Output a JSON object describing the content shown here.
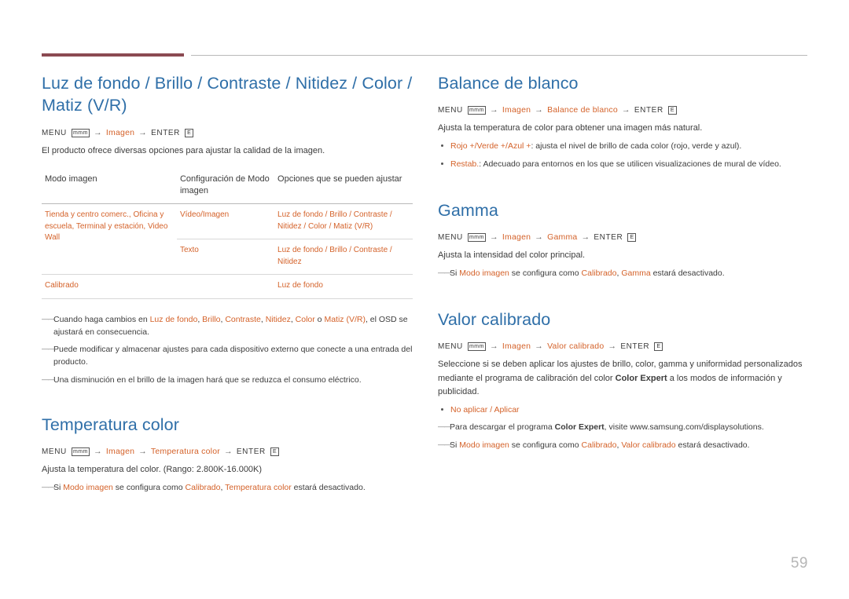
{
  "page": {
    "number": "59"
  },
  "left": {
    "title1": "Luz de fondo / Brillo / Contraste / Nitidez / Color / Matiz (V/R)",
    "path1": {
      "menu": "MENU",
      "menu_glyph": "mmm",
      "arrow": "→",
      "item1": "Imagen",
      "enter": "ENTER",
      "enter_glyph": "E"
    },
    "intro1": "El producto ofrece diversas opciones para ajustar la calidad de la imagen.",
    "table": {
      "headers": [
        "Modo imagen",
        "Configuración de Modo imagen",
        "Opciones que se pueden ajustar"
      ],
      "rows": [
        {
          "mode": "Tienda y centro comerc., Oficina y escuela, Terminal y estación, Video Wall",
          "config": "Vídeo/Imagen",
          "options": "Luz de fondo / Brillo / Contraste / Nitidez / Color / Matiz (V/R)"
        },
        {
          "mode": "",
          "config": "Texto",
          "options": "Luz de fondo / Brillo / Contraste / Nitidez"
        },
        {
          "mode": "Calibrado",
          "config": "",
          "options": "Luz de fondo"
        }
      ]
    },
    "notes": [
      "Cuando haga cambios en Luz de fondo, Brillo, Contraste, Nitidez, Color o Matiz (V/R), el OSD se ajustará en consecuencia.",
      "Puede modificar y almacenar ajustes para cada dispositivo externo que conecte a una entrada del producto.",
      "Una disminución en el brillo de la imagen hará que se reduzca el consumo eléctrico."
    ],
    "note1_parts": {
      "a": "Cuando haga cambios en ",
      "k1": "Luz de fondo",
      "s1": ", ",
      "k2": "Brillo",
      "s2": ", ",
      "k3": "Contraste",
      "s3": ", ",
      "k4": "Nitidez",
      "s4": ", ",
      "k5": "Color",
      "s5": " o ",
      "k6": "Matiz (V/R)",
      "b": ", el OSD se ajustará en consecuencia."
    },
    "title2": "Temperatura color",
    "path2": {
      "menu": "MENU",
      "menu_glyph": "mmm",
      "arrow": "→",
      "item1": "Imagen",
      "item2": "Temperatura color",
      "enter": "ENTER",
      "enter_glyph": "E"
    },
    "intro2": "Ajusta la temperatura del color. (Rango: 2.800K-16.000K)",
    "note2": {
      "a": "Si ",
      "k1": "Modo imagen",
      "b": " se configura como ",
      "k2": "Calibrado",
      "c": ", ",
      "k3": "Temperatura color",
      "d": " estará desactivado."
    }
  },
  "right": {
    "title1": "Balance de blanco",
    "path1": {
      "menu": "MENU",
      "menu_glyph": "mmm",
      "arrow": "→",
      "item1": "Imagen",
      "item2": "Balance de blanco",
      "enter": "ENTER",
      "enter_glyph": "E"
    },
    "intro1": "Ajusta la temperatura de color para obtener una imagen más natural.",
    "bullets1": [
      {
        "key": "Rojo +/Verde +/Azul +",
        "text": ": ajusta el nivel de brillo de cada color (rojo, verde y azul)."
      },
      {
        "key": "Restab.",
        "text": ": Adecuado para entornos en los que se utilicen visualizaciones de mural de vídeo."
      }
    ],
    "title2": "Gamma",
    "path2": {
      "menu": "MENU",
      "menu_glyph": "mmm",
      "arrow": "→",
      "item1": "Imagen",
      "item2": "Gamma",
      "enter": "ENTER",
      "enter_glyph": "E"
    },
    "intro2": "Ajusta la intensidad del color principal.",
    "note2": {
      "a": "Si ",
      "k1": "Modo imagen",
      "b": " se configura como ",
      "k2": "Calibrado",
      "c": ", ",
      "k3": "Gamma",
      "d": " estará desactivado."
    },
    "title3": "Valor calibrado",
    "path3": {
      "menu": "MENU",
      "menu_glyph": "mmm",
      "arrow": "→",
      "item1": "Imagen",
      "item2": "Valor calibrado",
      "enter": "ENTER",
      "enter_glyph": "E"
    },
    "intro3": {
      "a": "Seleccione si se deben aplicar los ajustes de brillo, color, gamma y uniformidad personalizados mediante el programa de calibración del color ",
      "k": "Color Expert",
      "b": " a los modos de información y publicidad."
    },
    "bullet3": "No aplicar / Aplicar",
    "note3a": {
      "a": "Para descargar el programa ",
      "k": "Color Expert",
      "b": ", visite www.samsung.com/displaysolutions."
    },
    "note3b": {
      "a": "Si ",
      "k1": "Modo imagen",
      "b": " se configura como ",
      "k2": "Calibrado",
      "c": ", ",
      "k3": "Valor calibrado",
      "d": " estará desactivado."
    }
  }
}
